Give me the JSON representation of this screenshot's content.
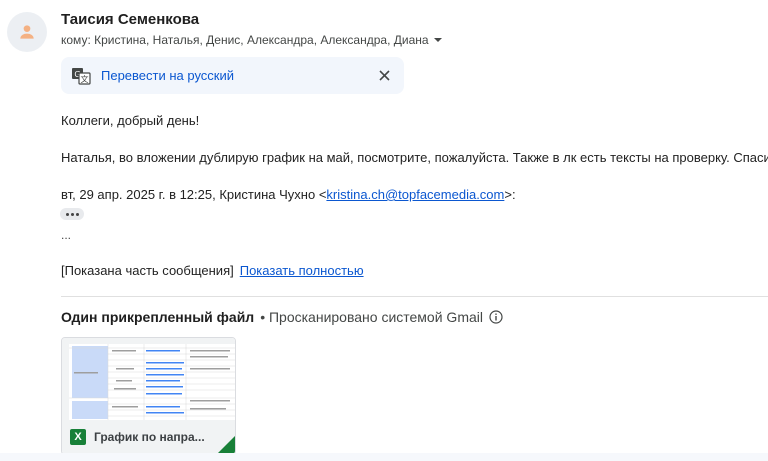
{
  "email": {
    "sender_name": "Таисия Семенкова",
    "to_line": "кому: Кристина, Наталья, Денис, Александра, Александра, Диана"
  },
  "translate": {
    "link": "Перевести на русский"
  },
  "body": {
    "greeting": "Коллеги, добрый день!",
    "message": "Наталья, во вложении дублирую график на май, посмотрите, пожалуйста. Также в лк есть тексты на проверку. Спасибо!",
    "quote_prefix": "вт, 29 апр. 2025 г. в 12:25, Кристина Чухно <",
    "quote_email": "kristina.ch@topfacemedia.com",
    "quote_suffix": ">:",
    "ellipsis": "...",
    "clipped_text": "[Показана часть сообщения]",
    "show_full": "Показать полностью"
  },
  "attachments": {
    "header_title": "Один прикрепленный файл",
    "scan_text": "• Просканировано системой Gmail",
    "files": [
      {
        "name": "График по напра...",
        "icon": "excel-icon",
        "icon_letter": "X"
      }
    ]
  },
  "colors": {
    "link": "#0b57d0",
    "excel_green": "#188038",
    "translate_bg": "#f2f6fc"
  }
}
